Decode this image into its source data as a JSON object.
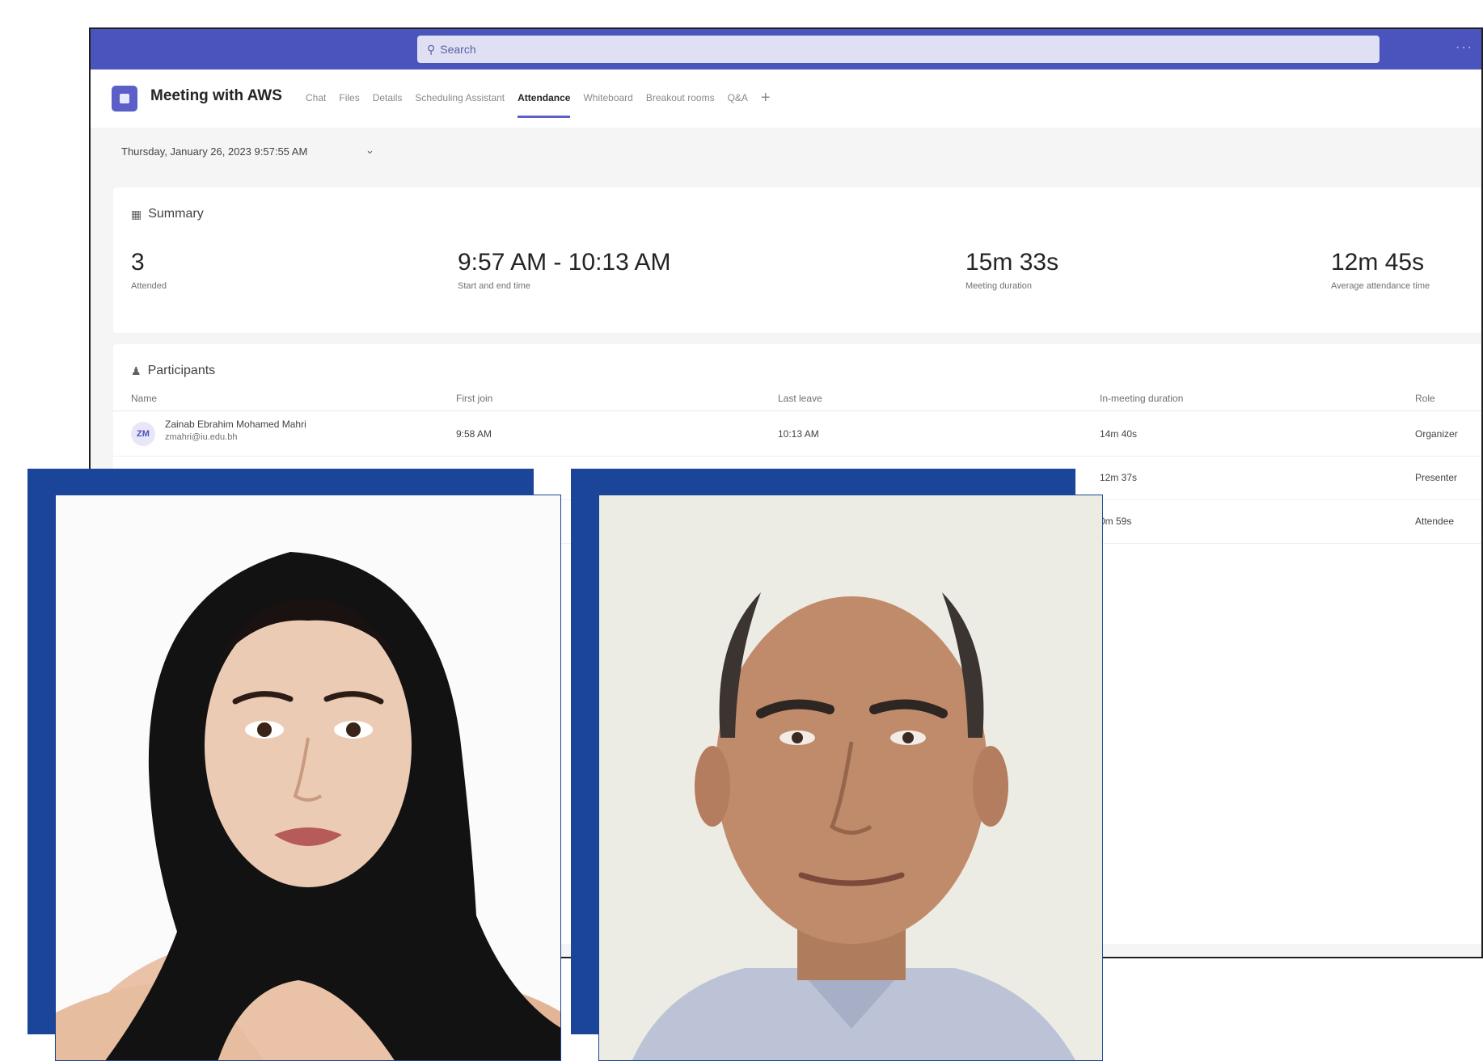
{
  "window": {
    "search_placeholder": "Search",
    "meeting_title": "Meeting with AWS",
    "tabs": [
      {
        "label": "Chat"
      },
      {
        "label": "Files"
      },
      {
        "label": "Details"
      },
      {
        "label": "Scheduling Assistant"
      },
      {
        "label": "Attendance"
      },
      {
        "label": "Whiteboard"
      },
      {
        "label": "Breakout rooms"
      },
      {
        "label": "Q&A"
      }
    ],
    "active_tab": "Attendance",
    "date_selector": "Thursday, January 26, 2023 9:57:55 AM"
  },
  "summary": {
    "heading": "Summary",
    "stats": [
      {
        "value": "3",
        "label": "Attended"
      },
      {
        "value": "9:57 AM - 10:13 AM",
        "label": "Start and end time"
      },
      {
        "value": "15m 33s",
        "label": "Meeting duration"
      },
      {
        "value": "12m 45s",
        "label": "Average attendance time"
      }
    ]
  },
  "participants": {
    "heading": "Participants",
    "columns": [
      "Name",
      "First join",
      "Last leave",
      "In-meeting duration",
      "Role"
    ],
    "rows": [
      {
        "initials": "ZM",
        "name": "Zainab Ebrahim Mohamed Mahri",
        "email": "zmahri@iu.edu.bh",
        "first_join": "9:58 AM",
        "last_leave": "10:13 AM",
        "duration": "14m 40s",
        "role": "Organizer"
      },
      {
        "initials": "",
        "name": "",
        "email": "",
        "first_join": "",
        "last_leave": "",
        "duration": "12m 37s",
        "role": "Presenter"
      },
      {
        "initials": "",
        "name": "",
        "email": "",
        "first_join": "",
        "last_leave": "",
        "duration": "0m 59s",
        "role": "Attendee"
      }
    ]
  },
  "colors": {
    "teams_purple": "#4b53bc",
    "frame_blue": "#1a4598"
  }
}
